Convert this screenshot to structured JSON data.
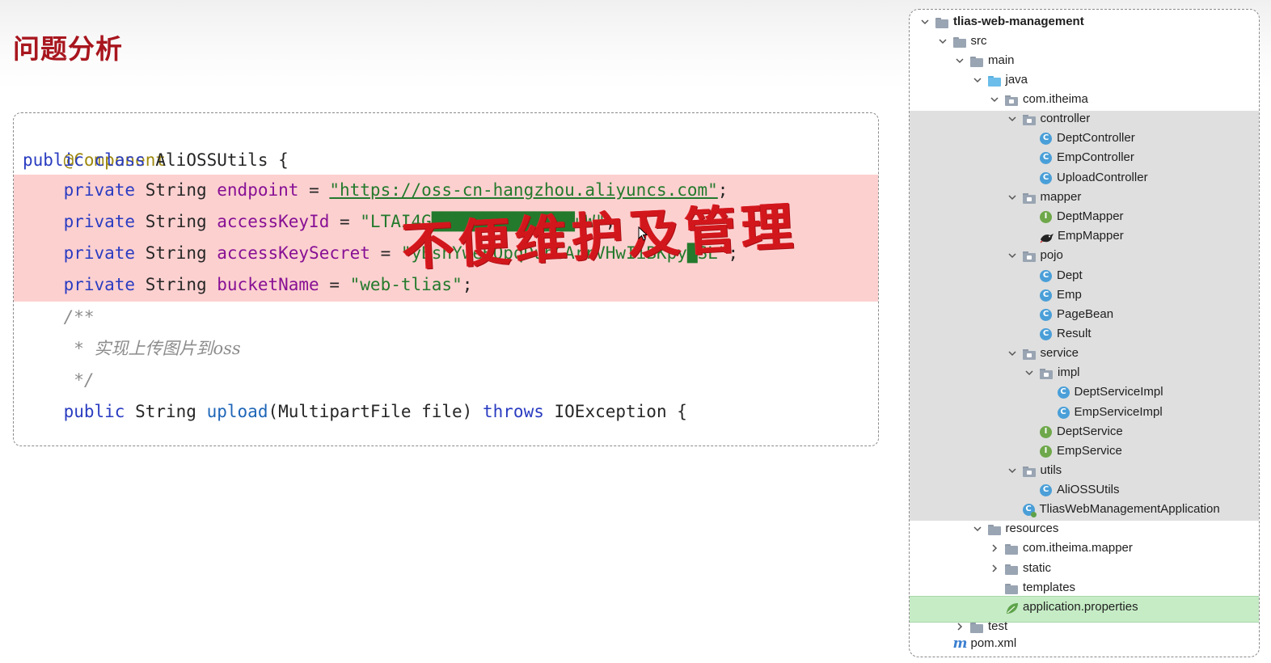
{
  "slide": {
    "title": "问题分析",
    "overlay_text": "不便维护及管理"
  },
  "code": {
    "annotation": "@Component",
    "class_line": {
      "kw1": "public",
      "kw2": "class",
      "name": "AliOSSUtils {"
    },
    "fields": [
      {
        "kw": "private",
        "type": "String",
        "name": "endpoint",
        "value": "\"https://oss-cn-hangzhou.aliyuncs.com\""
      },
      {
        "kw": "private",
        "type": "String",
        "name": "accessKeyId",
        "value": "\"LTAI4G██████████████uW\""
      },
      {
        "kw": "private",
        "type": "String",
        "name": "accessKeySecret",
        "value": "\"yBshYweHOpqDuhCArrVHwIiBKpy█SL\""
      },
      {
        "kw": "private",
        "type": "String",
        "name": "bucketName",
        "value": "\"web-tlias\""
      }
    ],
    "comment": {
      "open": "/**",
      "body_prefix": " * ",
      "body": "实现上传图片到oss",
      "close": " */"
    },
    "method_line": {
      "kw1": "public",
      "type": "String",
      "name": "upload",
      "params": "(MultipartFile file)",
      "throws_kw": "throws",
      "exception": "IOException {"
    }
  },
  "tree": {
    "items": [
      {
        "label": "tlias-web-management",
        "icon": "module-folder-icon",
        "expanded": true,
        "bold": true
      },
      {
        "label": "src",
        "icon": "folder-icon",
        "expanded": true
      },
      {
        "label": "main",
        "icon": "folder-icon",
        "expanded": true
      },
      {
        "label": "java",
        "icon": "source-folder-icon",
        "expanded": true
      },
      {
        "label": "com.itheima",
        "icon": "package-icon",
        "expanded": true
      },
      {
        "label": "controller",
        "icon": "package-icon",
        "expanded": true
      },
      {
        "label": "DeptController",
        "icon": "class-icon"
      },
      {
        "label": "EmpController",
        "icon": "class-icon"
      },
      {
        "label": "UploadController",
        "icon": "class-icon"
      },
      {
        "label": "mapper",
        "icon": "package-icon",
        "expanded": true
      },
      {
        "label": "DeptMapper",
        "icon": "interface-icon"
      },
      {
        "label": "EmpMapper",
        "icon": "mybatis-bird-icon"
      },
      {
        "label": "pojo",
        "icon": "package-icon",
        "expanded": true
      },
      {
        "label": "Dept",
        "icon": "class-icon"
      },
      {
        "label": "Emp",
        "icon": "class-icon"
      },
      {
        "label": "PageBean",
        "icon": "class-icon"
      },
      {
        "label": "Result",
        "icon": "class-icon"
      },
      {
        "label": "service",
        "icon": "package-icon",
        "expanded": true
      },
      {
        "label": "impl",
        "icon": "package-icon",
        "expanded": true
      },
      {
        "label": "DeptServiceImpl",
        "icon": "class-icon"
      },
      {
        "label": "EmpServiceImpl",
        "icon": "class-icon"
      },
      {
        "label": "DeptService",
        "icon": "interface-icon"
      },
      {
        "label": "EmpService",
        "icon": "interface-icon"
      },
      {
        "label": "utils",
        "icon": "package-icon",
        "expanded": true
      },
      {
        "label": "AliOSSUtils",
        "icon": "class-icon"
      },
      {
        "label": "TliasWebManagementApplication",
        "icon": "spring-app-icon"
      },
      {
        "label": "resources",
        "icon": "resources-folder-icon",
        "expanded": true
      },
      {
        "label": "com.itheima.mapper",
        "icon": "folder-icon",
        "expanded": false
      },
      {
        "label": "static",
        "icon": "folder-icon",
        "expanded": false
      },
      {
        "label": "templates",
        "icon": "folder-icon"
      },
      {
        "label": "application.properties",
        "icon": "spring-leaf-icon",
        "selected": true
      },
      {
        "label": "test",
        "icon": "folder-icon",
        "expanded": false
      },
      {
        "label": "pom.xml",
        "icon": "maven-icon"
      }
    ],
    "badge_letters": {
      "class": "C",
      "interface": "I",
      "maven": "m"
    }
  },
  "colors": {
    "title_red": "#a8161e",
    "highlight_pink": "#fdd0d0",
    "overlay_red": "#d2171c",
    "tree_selection_gray": "#dfdfdf",
    "tree_selection_green": "#c6ecc6"
  }
}
